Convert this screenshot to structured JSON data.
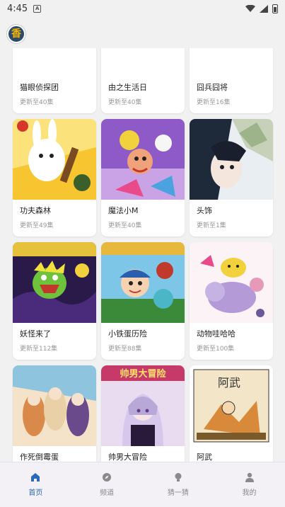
{
  "status": {
    "time": "4:45",
    "notification_icon": "A"
  },
  "header": {
    "logo_char": "香"
  },
  "comics": [
    {
      "title": "猫眼侦探团",
      "update": "更新至40集",
      "cover": "cover-orange-detective"
    },
    {
      "title": "由之生活日",
      "update": "更新至40集",
      "cover": "cover-pink-daily-life"
    },
    {
      "title": "囧兵囧将",
      "update": "更新至16集",
      "cover": "cover-red-soldiers"
    },
    {
      "title": "功夫森林",
      "update": "更新至49集",
      "cover": "cover-kungfu-rabbit"
    },
    {
      "title": "魔法小M",
      "update": "更新至40集",
      "cover": "cover-magic-girl"
    },
    {
      "title": "头饰",
      "update": "更新至1集",
      "cover": "cover-dark-hair"
    },
    {
      "title": "妖怪来了",
      "update": "更新至112集",
      "cover": "cover-green-monster"
    },
    {
      "title": "小铁蛋历险",
      "update": "更新至88集",
      "cover": "cover-boy-adventure"
    },
    {
      "title": "动物哇哈哈",
      "update": "更新至100集",
      "cover": "cover-animals"
    },
    {
      "title": "作死倒霉蛋",
      "update": "",
      "cover": "cover-anime-group"
    },
    {
      "title": "帅男大冒险",
      "update": "",
      "cover": "cover-handsome-adventure"
    },
    {
      "title": "阿武",
      "update": "",
      "cover": "cover-awu"
    }
  ],
  "tabs": [
    {
      "label": "首页",
      "icon": "home-icon",
      "active": true
    },
    {
      "label": "频道",
      "icon": "compass-icon",
      "active": false
    },
    {
      "label": "猜一猜",
      "icon": "bulb-icon",
      "active": false
    },
    {
      "label": "我的",
      "icon": "person-icon",
      "active": false
    }
  ],
  "colors": {
    "accent": "#2a6ab8",
    "inactive": "#8a8a8a",
    "tabbar_bg": "#f4f1f6"
  }
}
